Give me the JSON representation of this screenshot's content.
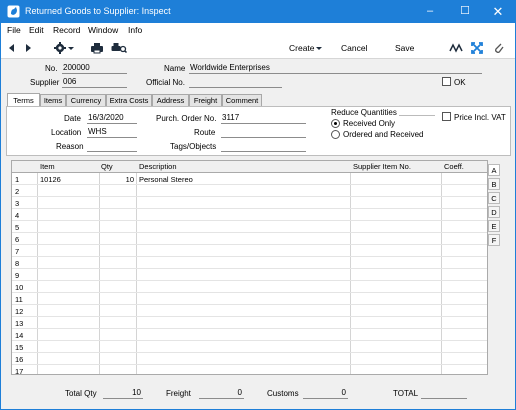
{
  "window": {
    "title": "Returned Goods to Supplier: Inspect"
  },
  "menu": [
    "File",
    "Edit",
    "Record",
    "Window",
    "Info"
  ],
  "toolbar": {
    "create": "Create",
    "cancel": "Cancel",
    "save": "Save"
  },
  "header": {
    "no_label": "No.",
    "no_value": "200000",
    "name_label": "Name",
    "name_value": "Worldwide Enterprises",
    "supplier_label": "Supplier",
    "supplier_value": "006",
    "official_label": "Official No.",
    "official_value": "",
    "ok_label": "OK"
  },
  "tabs": [
    "Terms",
    "Items",
    "Currency",
    "Extra Costs",
    "Address",
    "Freight",
    "Comment"
  ],
  "terms": {
    "date_label": "Date",
    "date_value": "16/3/2020",
    "location_label": "Location",
    "location_value": "WHS",
    "reason_label": "Reason",
    "reason_value": "",
    "po_label": "Purch. Order No.",
    "po_value": "3117",
    "route_label": "Route",
    "route_value": "",
    "tags_label": "Tags/Objects",
    "tags_value": "",
    "reduce_label": "Reduce Quantities",
    "received_only": "Received Only",
    "ordered_received": "Ordered and Received",
    "price_incl_vat": "Price  Incl. VAT"
  },
  "grid": {
    "columns": [
      "Item",
      "Qty",
      "Description",
      "Supplier Item No.",
      "Coeff."
    ],
    "rows": [
      {
        "n": "1",
        "item": "10126",
        "qty": "10",
        "desc": "Personal Stereo",
        "supp": "",
        "coeff": ""
      },
      {
        "n": "2"
      },
      {
        "n": "3"
      },
      {
        "n": "4"
      },
      {
        "n": "5"
      },
      {
        "n": "6"
      },
      {
        "n": "7"
      },
      {
        "n": "8"
      },
      {
        "n": "9"
      },
      {
        "n": "10"
      },
      {
        "n": "11"
      },
      {
        "n": "12"
      },
      {
        "n": "13"
      },
      {
        "n": "14"
      },
      {
        "n": "15"
      },
      {
        "n": "16"
      },
      {
        "n": "17"
      }
    ]
  },
  "side_tabs": [
    "A",
    "B",
    "C",
    "D",
    "E",
    "F"
  ],
  "footer": {
    "total_qty_label": "Total Qty",
    "total_qty_value": "10",
    "freight_label": "Freight",
    "freight_value": "0",
    "customs_label": "Customs",
    "customs_value": "0",
    "total_label": "TOTAL",
    "total_value": ""
  }
}
